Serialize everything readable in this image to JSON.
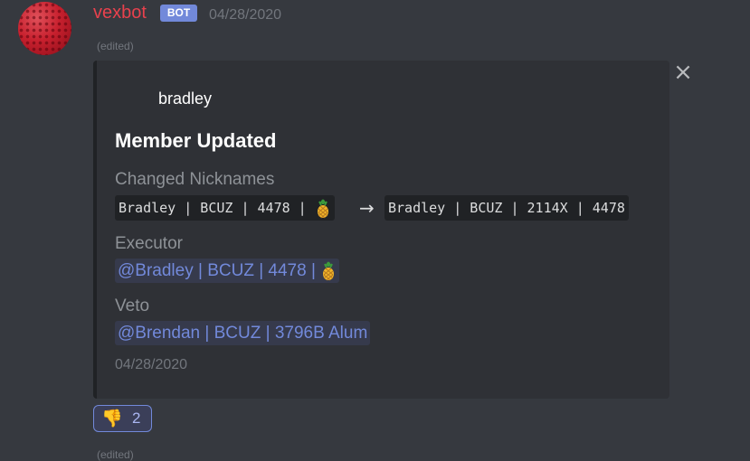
{
  "message": {
    "username": "vexbot",
    "badge": "BOT",
    "timestamp": "04/28/2020",
    "edited": "(edited)",
    "edited_next": "(edited)"
  },
  "embed": {
    "author": "bradley",
    "title": "Member Updated",
    "fields": [
      {
        "name": "Changed Nicknames",
        "old_value": "Bradley | BCUZ | 4478 | ",
        "arrow": "→",
        "new_value": "Bradley | BCUZ | 2114X | 4478"
      },
      {
        "name": "Executor",
        "value": "@Bradley | BCUZ | 4478 | "
      },
      {
        "name": "Veto",
        "value": "@Brendan | BCUZ | 3796B Alum"
      }
    ],
    "footer": "04/28/2020",
    "close_symbol": "×"
  },
  "reaction": {
    "emoji": "👎",
    "count": "2"
  },
  "icons": {
    "pineapple": "pineapple-icon",
    "close": "close-icon",
    "thumbs_down": "thumbs-down-icon"
  },
  "colors": {
    "username": "#e8414d",
    "badge": "#7289da",
    "mention": "#7289da",
    "embed_bg": "#2f3136",
    "background": "#36393f"
  }
}
